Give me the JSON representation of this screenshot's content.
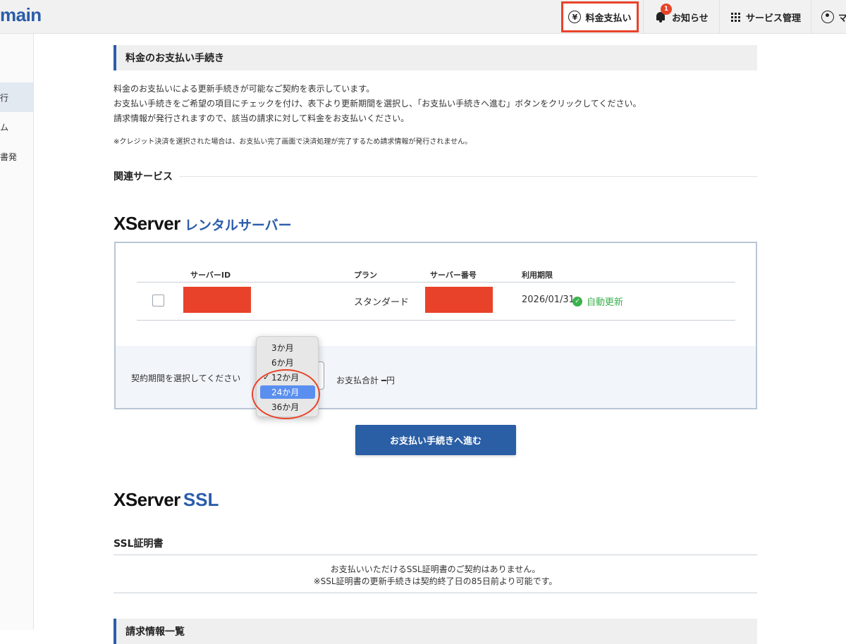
{
  "header": {
    "brand": "main",
    "nav": {
      "payment": "料金支払い",
      "payment_icon": "¥",
      "news": "お知らせ",
      "news_badge": "1",
      "services": "サービス管理",
      "mypage": "マ"
    }
  },
  "sidebar": {
    "items": [
      {
        "label": "行"
      },
      {
        "label": "ム"
      },
      {
        "label": "書発"
      }
    ]
  },
  "main": {
    "title": "料金のお支払い手続き",
    "description": [
      "料金のお支払いによる更新手続きが可能なご契約を表示しています。",
      "お支払い手続きをご希望の項目にチェックを付け、表下より更新期間を選択し、「お支払い手続きへ進む」ボタンをクリックしてください。",
      "請求情報が発行されますので、該当の請求に対して料金をお支払いください。"
    ],
    "note": "※クレジット決済を選択された場合は、お支払い完了画面で決済処理が完了するため請求情報が発行されません。",
    "related_label": "関連サービス"
  },
  "rental": {
    "logo_main": "XServer",
    "logo_sub": "レンタルサーバー",
    "columns": {
      "server_id": "サーバーID",
      "plan": "プラン",
      "server_number": "サーバー番号",
      "expiry": "利用期限"
    },
    "row": {
      "plan": "スタンダード",
      "expiry": "2026/01/31",
      "auto_renew": "自動更新"
    },
    "period_label": "契約期間を選択してください",
    "total_label": "お支払合計 ━円",
    "dropdown": {
      "options": [
        "3か月",
        "6か月",
        "12か月",
        "24か月",
        "36か月"
      ],
      "checked": "12か月",
      "highlighted": "24か月"
    },
    "proceed_button": "お支払い手続きへ進む"
  },
  "ssl": {
    "logo_main": "XServer",
    "logo_sub": "SSL",
    "heading": "SSL証明書",
    "message_1": "お支払いいただけるSSL証明書のご契約はありません。",
    "message_2": "※SSL証明書の更新手続きは契約終了日の85日前より可能です。"
  },
  "bottom_section": {
    "title": "請求情報一覧"
  },
  "colors": {
    "accent": "#2a5caa",
    "highlight_red": "#e8432a",
    "success": "#3bb24c",
    "button": "#2a5ea5"
  }
}
